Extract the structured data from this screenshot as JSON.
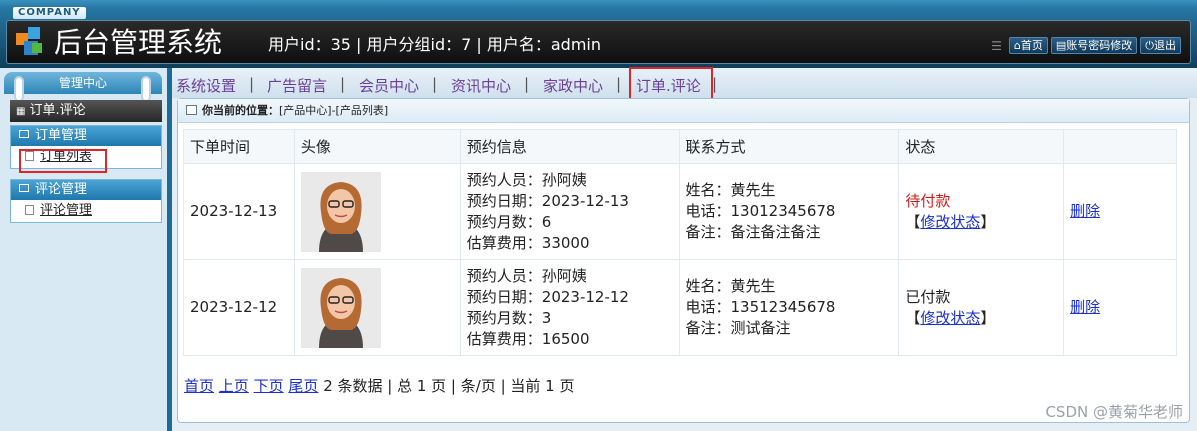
{
  "header": {
    "company": "COMPANY",
    "title": "后台管理系统",
    "user_info": "用户id：35 | 用户分组id：7 | 用户名：admin",
    "buttons": [
      "首页",
      "账号密码修改",
      "退出"
    ]
  },
  "sidebar": {
    "top_label": "管理中心",
    "active_section": "订单.评论",
    "groups": [
      {
        "title": "订单管理",
        "items": [
          "订单列表"
        ]
      },
      {
        "title": "评论管理",
        "items": [
          "评论管理"
        ]
      }
    ]
  },
  "topnav": {
    "items": [
      "系统设置",
      "广告留言",
      "会员中心",
      "资讯中心",
      "家政中心",
      "订单.评论"
    ]
  },
  "breadcrumb": {
    "label": "你当前的位置：",
    "path": "[产品中心]-[产品列表]"
  },
  "table": {
    "headers": [
      "下单时间",
      "头像",
      "预约信息",
      "联系方式",
      "状态",
      ""
    ],
    "rows": [
      {
        "date": "2023-12-13",
        "booking": [
          "预约人员：孙阿姨",
          "预约日期：2023-12-13",
          "预约月数：6",
          "估算费用：33000"
        ],
        "contact": [
          "姓名：黄先生",
          "电话：13012345678",
          "备注：备注备注备注"
        ],
        "status": "待付款",
        "status_color": "#d51a1a",
        "modify": "修改状态",
        "delete": "删除"
      },
      {
        "date": "2023-12-12",
        "booking": [
          "预约人员：孙阿姨",
          "预约日期：2023-12-12",
          "预约月数：3",
          "估算费用：16500"
        ],
        "contact": [
          "姓名：黄先生",
          "电话：13512345678",
          "备注：测试备注"
        ],
        "status": "已付款",
        "status_color": "#222222",
        "modify": "修改状态",
        "delete": "删除"
      }
    ]
  },
  "pager": {
    "first": "首页",
    "prev": "上页",
    "next": "下页",
    "last": "尾页",
    "summary": "2 条数据 | 总 1 页 | 条/页 | 当前 1 页"
  },
  "watermark": "CSDN @黄菊华老师"
}
